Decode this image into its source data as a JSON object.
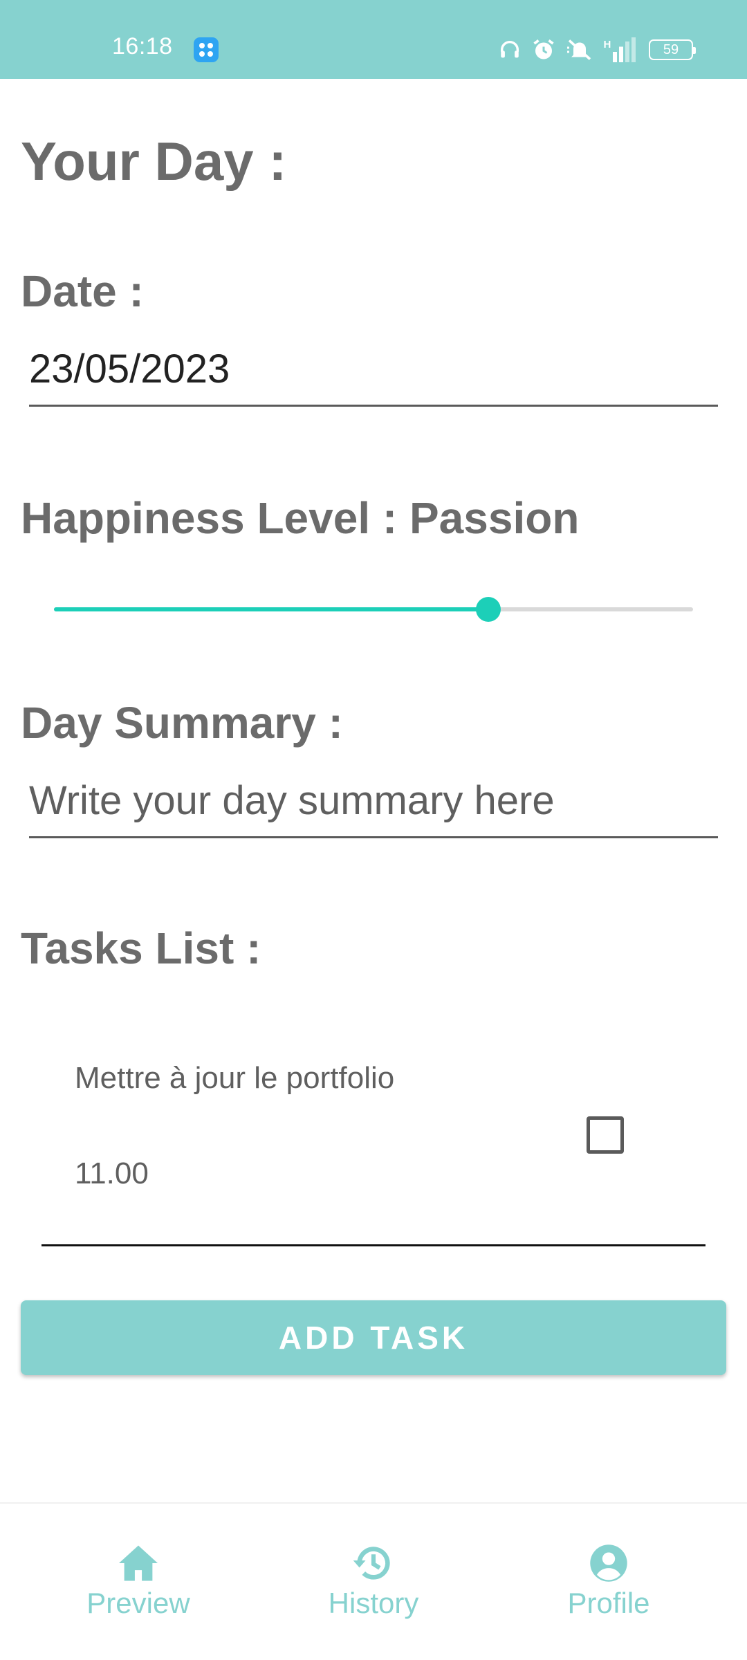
{
  "status_bar": {
    "time": "16:18",
    "battery": "59"
  },
  "page": {
    "title": "Your Day :"
  },
  "date_section": {
    "label": "Date :",
    "value": "23/05/2023"
  },
  "happiness_section": {
    "label": "Happiness Level : Passion",
    "slider_level": 0.68
  },
  "summary_section": {
    "label": "Day Summary :",
    "placeholder": "Write your day summary here"
  },
  "tasks_section": {
    "label": "Tasks List :",
    "items": [
      {
        "title": "Mettre à jour le portfolio",
        "time": "11.00",
        "checked": false
      }
    ],
    "add_button_label": "ADD TASK"
  },
  "bottom_nav": {
    "items": [
      {
        "label": "Preview",
        "icon": "home-icon"
      },
      {
        "label": "History",
        "icon": "history-icon"
      },
      {
        "label": "Profile",
        "icon": "profile-icon"
      }
    ]
  },
  "colors": {
    "accent": "#86d2cf",
    "slider": "#1ccfb8",
    "label_text": "#6b6b6b"
  }
}
